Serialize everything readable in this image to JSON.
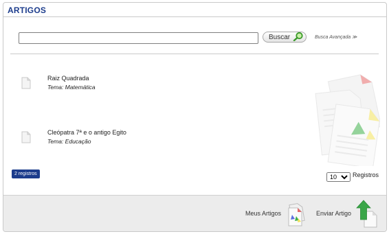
{
  "header": {
    "title": "ARTIGOS"
  },
  "search": {
    "value": "",
    "placeholder": "",
    "button_label": "Buscar",
    "advanced_label": "Busca Avançada ≫"
  },
  "articles": [
    {
      "title": "Raiz Quadrada",
      "tema": "Tema: Matemática"
    },
    {
      "title": "Cleópatra 7ª e o antigo Egito",
      "tema": "Tema: Educação"
    }
  ],
  "count_badge": "2 registros",
  "pagination": {
    "selected": "10",
    "options": [
      "10"
    ],
    "label": "Registros"
  },
  "footer": {
    "my_articles_label": "Meus Artigos",
    "send_article_label": "Enviar Artigo"
  },
  "colors": {
    "accent": "#1c3c8c",
    "footer_bg": "#ececec",
    "upload_arrow": "#3aa648"
  },
  "icons": {
    "article": "document-icon",
    "search": "magnifier-icon",
    "my_articles": "documents-icon",
    "send_article": "upload-arrow-icon"
  }
}
